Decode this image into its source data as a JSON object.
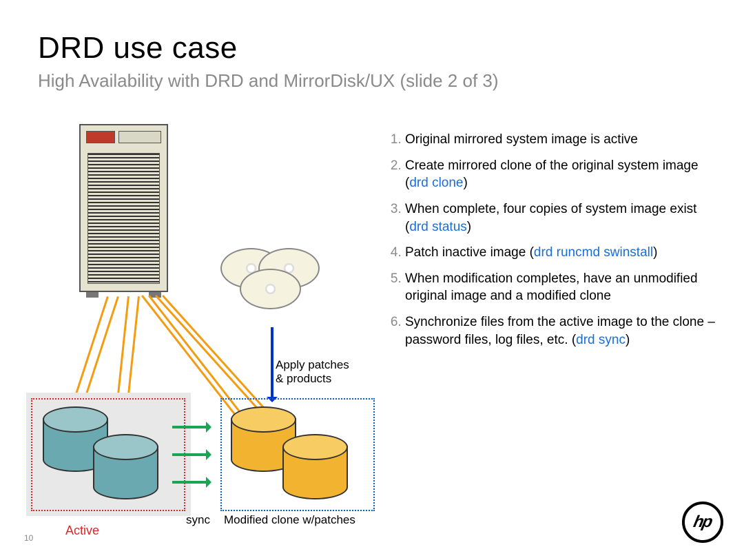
{
  "title": "DRD use case",
  "subtitle": "High Availability with DRD and MirrorDisk/UX (slide 2 of 3)",
  "diagram": {
    "apply_label_line1": "Apply patches",
    "apply_label_line2": "& products",
    "sync_label": "sync",
    "active_label": "Active",
    "clone_label": "Modified clone w/patches"
  },
  "list": {
    "item1": "Original mirrored system image is active",
    "item2_a": "Create mirrored clone of the original system image (",
    "item2_cmd": "drd clone",
    "item2_b": ")",
    "item3_a": "When complete, four copies of system image exist (",
    "item3_cmd": "drd status",
    "item3_b": ")",
    "item4_a": "Patch inactive image (",
    "item4_cmd": "drd runcmd swinstall",
    "item4_b": ")",
    "item5": "When modification completes, have an unmodified original image and a modified clone",
    "item6_a": "Synchronize files from the active image to the clone – password files, log files, etc. (",
    "item6_cmd": "drd sync",
    "item6_b": ")"
  },
  "page_number": "10",
  "logo_text": "hp"
}
